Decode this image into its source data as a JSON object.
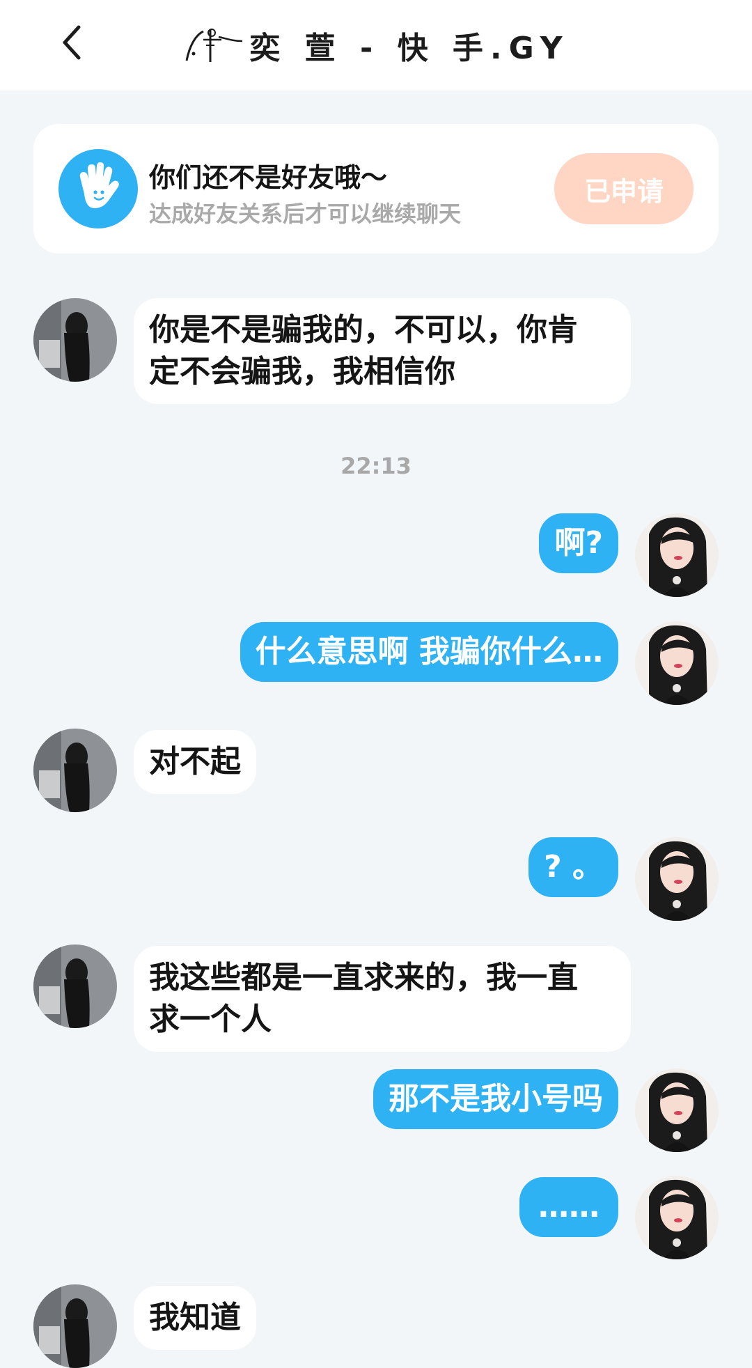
{
  "header": {
    "title": "奕 萱 - 快 手.GY"
  },
  "notice": {
    "title": "你们还不是好友哦～",
    "subtitle": "达成好友关系后才可以继续聊天",
    "button_label": "已申请"
  },
  "timestamp": "22:13",
  "messages": [
    {
      "side": "in",
      "text_line1": "你是不是骗我的，不可以，你肯",
      "text_line2": "定不会骗我，我相信你"
    },
    {
      "side": "out",
      "text": "啊?"
    },
    {
      "side": "out",
      "text": "什么意思啊  我骗你什么…"
    },
    {
      "side": "in",
      "text": "对不起"
    },
    {
      "side": "out",
      "text": "? 。"
    },
    {
      "side": "in",
      "text_line1": "我这些都是一直求来的，我一直",
      "text_line2": "求一个人"
    },
    {
      "side": "out",
      "text": "那不是我小号吗"
    },
    {
      "side": "out",
      "text": "……"
    },
    {
      "side": "in",
      "text": "我知道"
    }
  ],
  "colors": {
    "accent_blue": "#2fb2f3",
    "apply_button": "#ffd6c4",
    "background": "#f3f6f9"
  }
}
